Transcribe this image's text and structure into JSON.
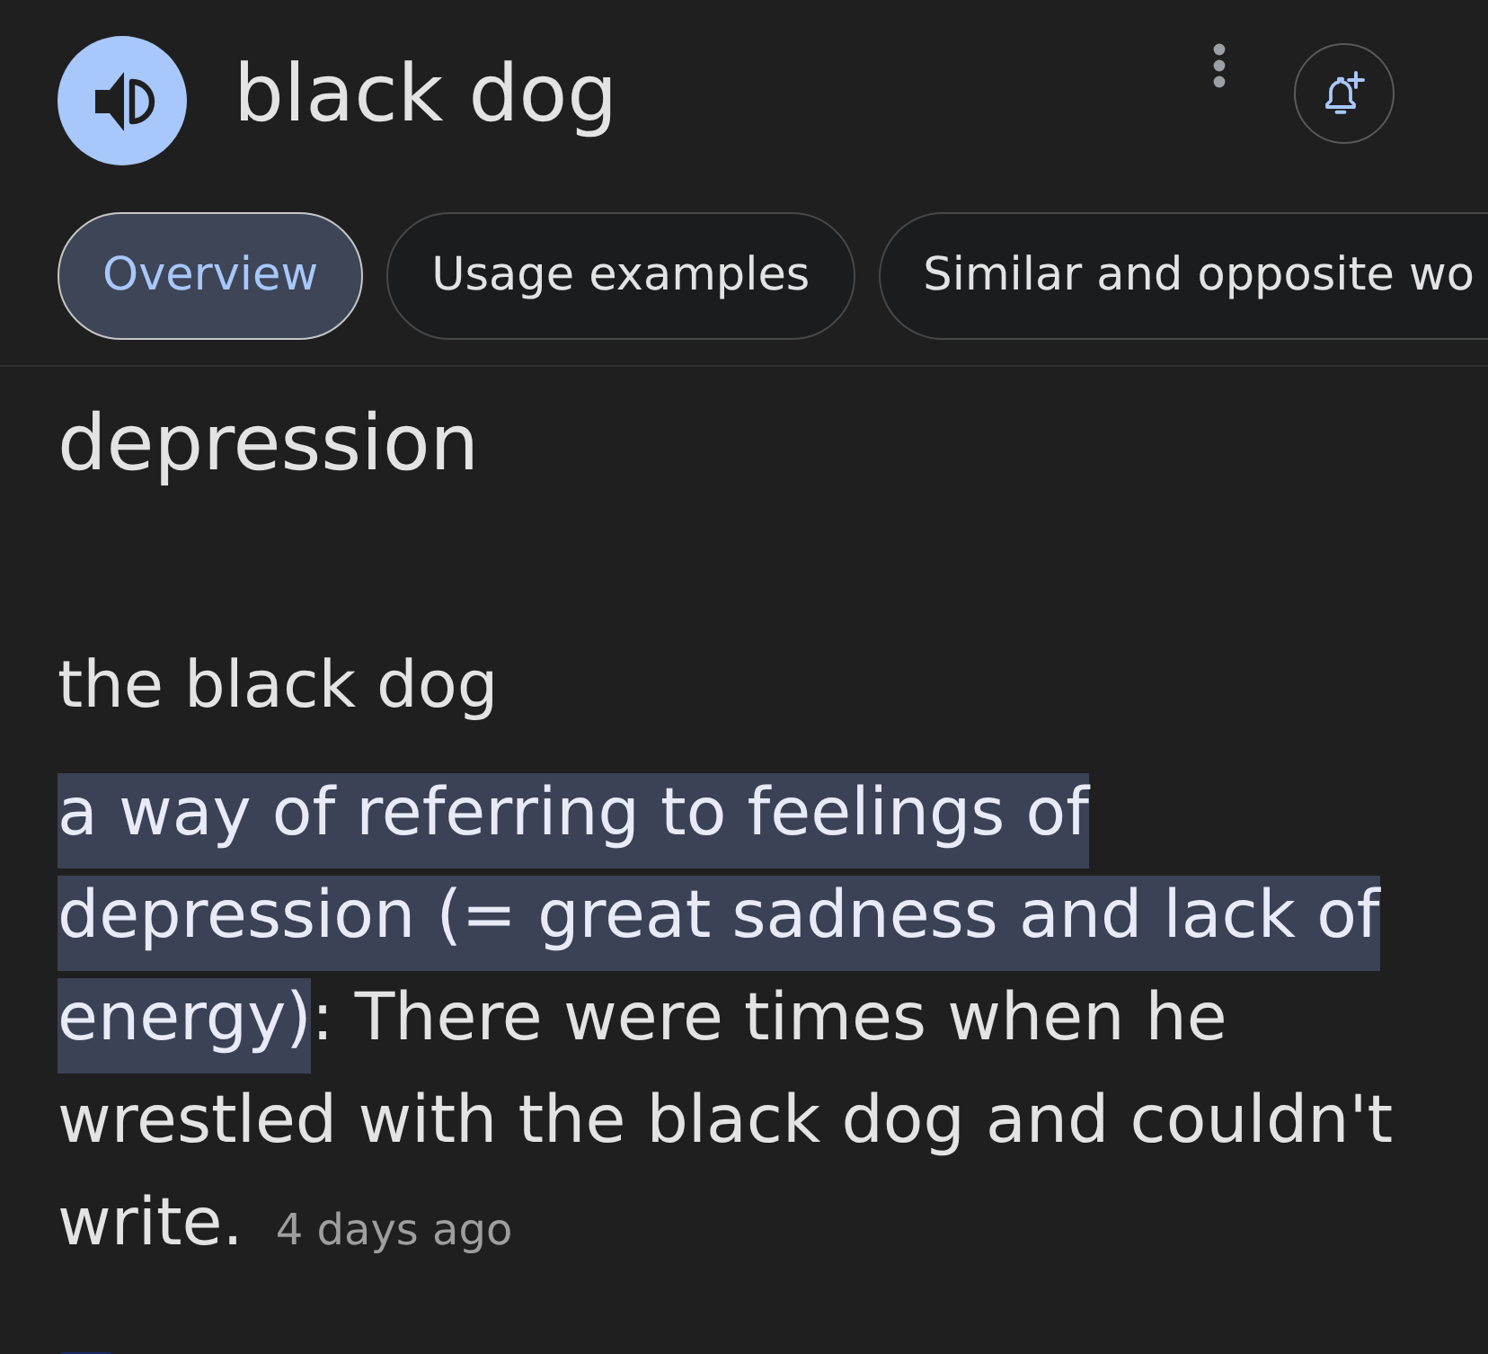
{
  "header": {
    "title": "black dog"
  },
  "tabs": [
    {
      "label": "Overview",
      "selected": true
    },
    {
      "label": "Usage examples",
      "selected": false
    },
    {
      "label": "Similar and opposite wo",
      "selected": false
    }
  ],
  "entry": {
    "heading": "depression",
    "phrase": "the black dog",
    "definition": {
      "text": "a way of referring to feelings of depression (= great sadness and lack of energy)",
      "highlighted": true
    },
    "example": ": There were times when he wrestled with the black dog and couldn't write.",
    "time": "4 days ago"
  }
}
